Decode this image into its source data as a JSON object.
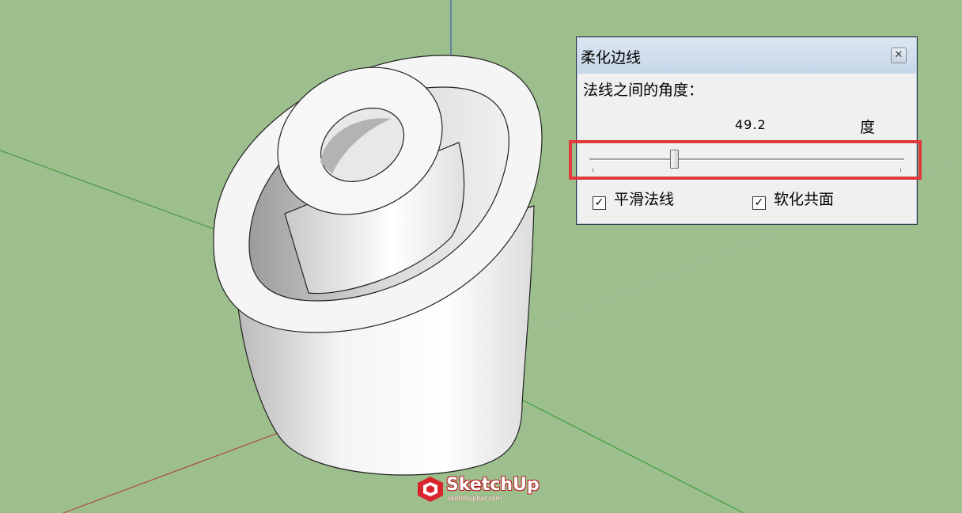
{
  "dialog": {
    "title": "柔化边线",
    "close_glyph": "✕",
    "angle_label": "法线之间的角度：",
    "angle_value": "49.2",
    "angle_unit": "度",
    "slider_fraction": 0.27,
    "smooth_normals": {
      "label": "平滑法线",
      "checked": true
    },
    "soften_coplanar": {
      "label": "软化共面",
      "checked": true
    }
  },
  "watermark": {
    "brand": "SketchUp",
    "url": "sketchupbar.com"
  },
  "colors": {
    "background": "#9dbf8d",
    "highlight": "#e0393a",
    "brand_red": "#d8262c"
  }
}
